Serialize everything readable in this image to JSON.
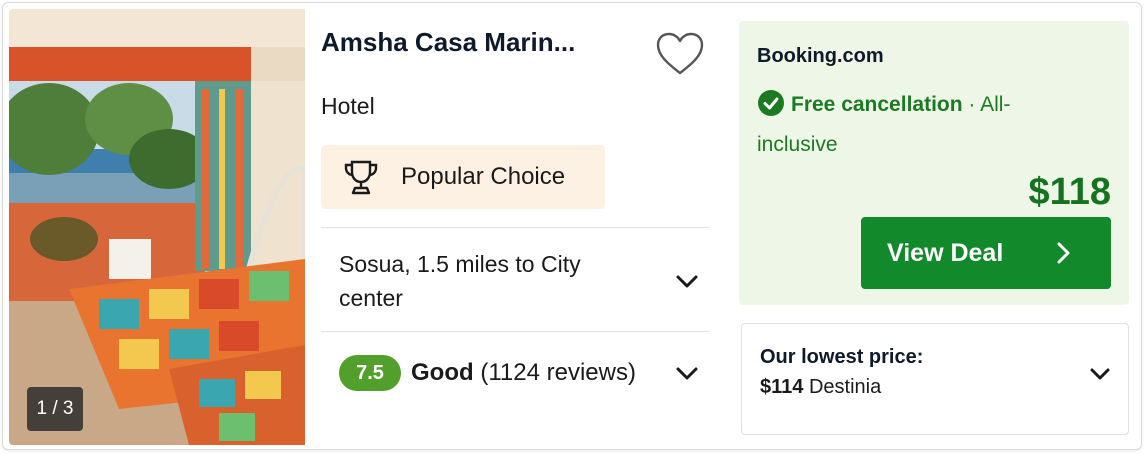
{
  "photo": {
    "counter": "1 / 3"
  },
  "hotel": {
    "name": "Amsha Casa Marin...",
    "type": "Hotel",
    "badge_label": "Popular Choice",
    "location": "Sosua, 1.5 miles to City center",
    "rating": {
      "score": "7.5",
      "word": "Good",
      "reviews": "(1124 reviews)"
    }
  },
  "deal": {
    "provider": "Booking.com",
    "cancellation": "Free cancellation",
    "separator": "·",
    "board": "All-inclusive",
    "price": "$118",
    "button_label": "View Deal"
  },
  "lowest": {
    "title": "Our lowest price:",
    "price": "$114",
    "provider": "Destinia"
  },
  "colors": {
    "score_green": "#52a02b",
    "deal_green": "#128a2c",
    "price_green": "#15731f",
    "deal_bg": "#eef7e7",
    "badge_bg": "#fdf1e3"
  },
  "icons": [
    "heart-icon",
    "trophy-icon",
    "chevron-down-icon",
    "check-circle-icon",
    "chevron-right-icon"
  ]
}
